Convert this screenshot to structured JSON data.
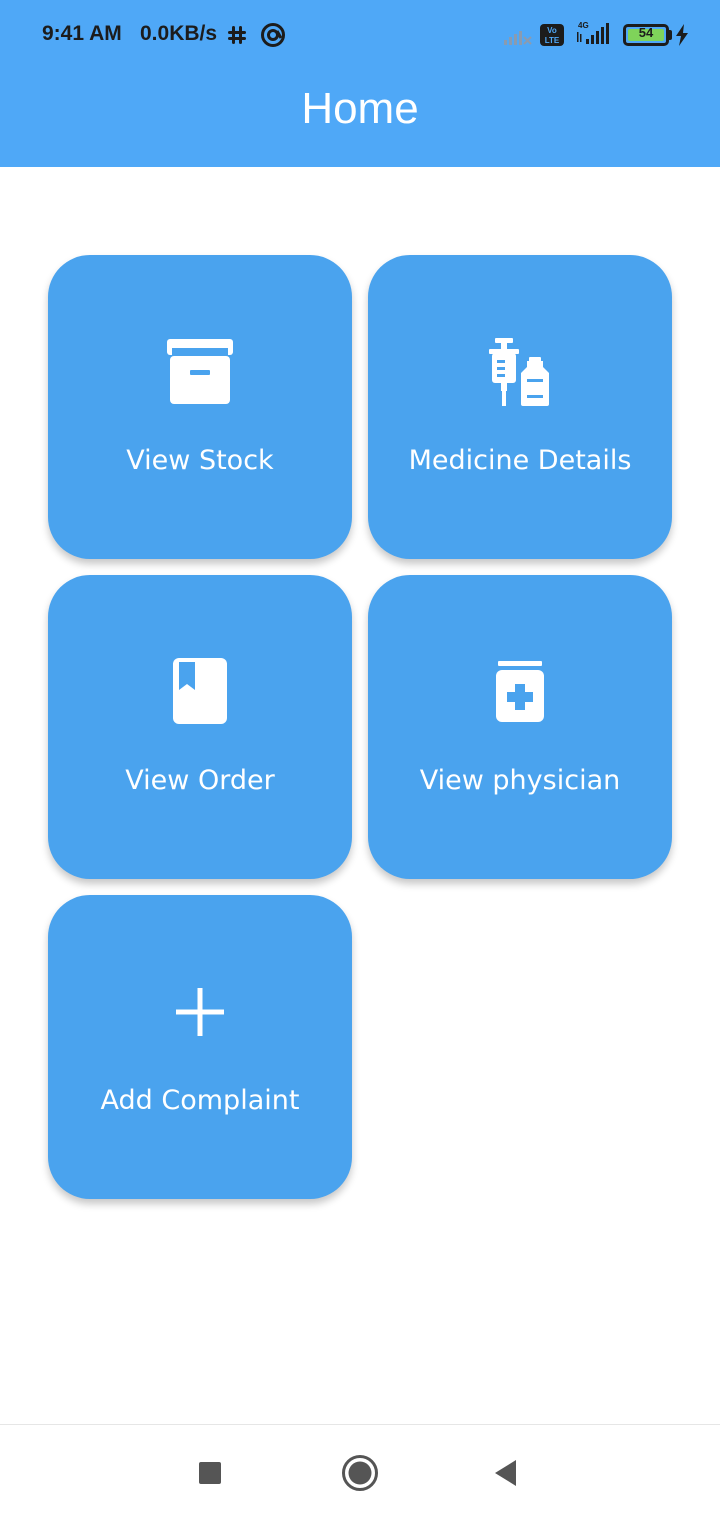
{
  "status_bar": {
    "time": "9:41 AM",
    "speed": "0.0KB/s",
    "battery": "54",
    "icons": [
      "slack-icon",
      "circle-at-icon",
      "signal-empty-icon",
      "volte-icon",
      "signal-4g-icon",
      "battery-icon",
      "charging-icon"
    ]
  },
  "header": {
    "title": "Home"
  },
  "tiles": [
    {
      "label": "View Stock",
      "icon": "archive-box-icon"
    },
    {
      "label": "Medicine Details",
      "icon": "syringe-vial-icon"
    },
    {
      "label": "View Order",
      "icon": "bookmark-book-icon"
    },
    {
      "label": "View physician",
      "icon": "medicine-jar-icon"
    },
    {
      "label": "Add Complaint",
      "icon": "plus-icon"
    }
  ],
  "nav": {
    "buttons": [
      "recents-button",
      "home-button",
      "back-button"
    ]
  },
  "colors": {
    "appbar": "#4fa8f7",
    "tile": "#4aa3ee",
    "text_on_blue": "#ffffff"
  }
}
